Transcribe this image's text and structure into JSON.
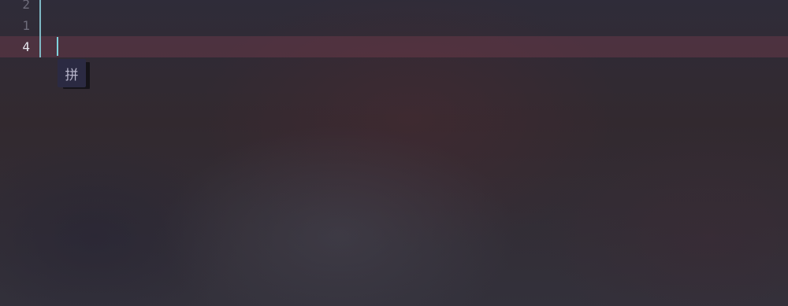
{
  "editor": {
    "line_numbers": [
      {
        "label": "2",
        "current": false
      },
      {
        "label": "1",
        "current": false
      },
      {
        "label": "4",
        "current": true
      }
    ]
  },
  "ime": {
    "mode_label": "拼"
  },
  "colors": {
    "accent": "#7fb8c4",
    "cursor": "#7fd3dc",
    "current_line": "#5a3644",
    "line_number": "#6e6c7a",
    "line_number_current": "#e6e6ee",
    "ime_background": "#2b2a42"
  }
}
